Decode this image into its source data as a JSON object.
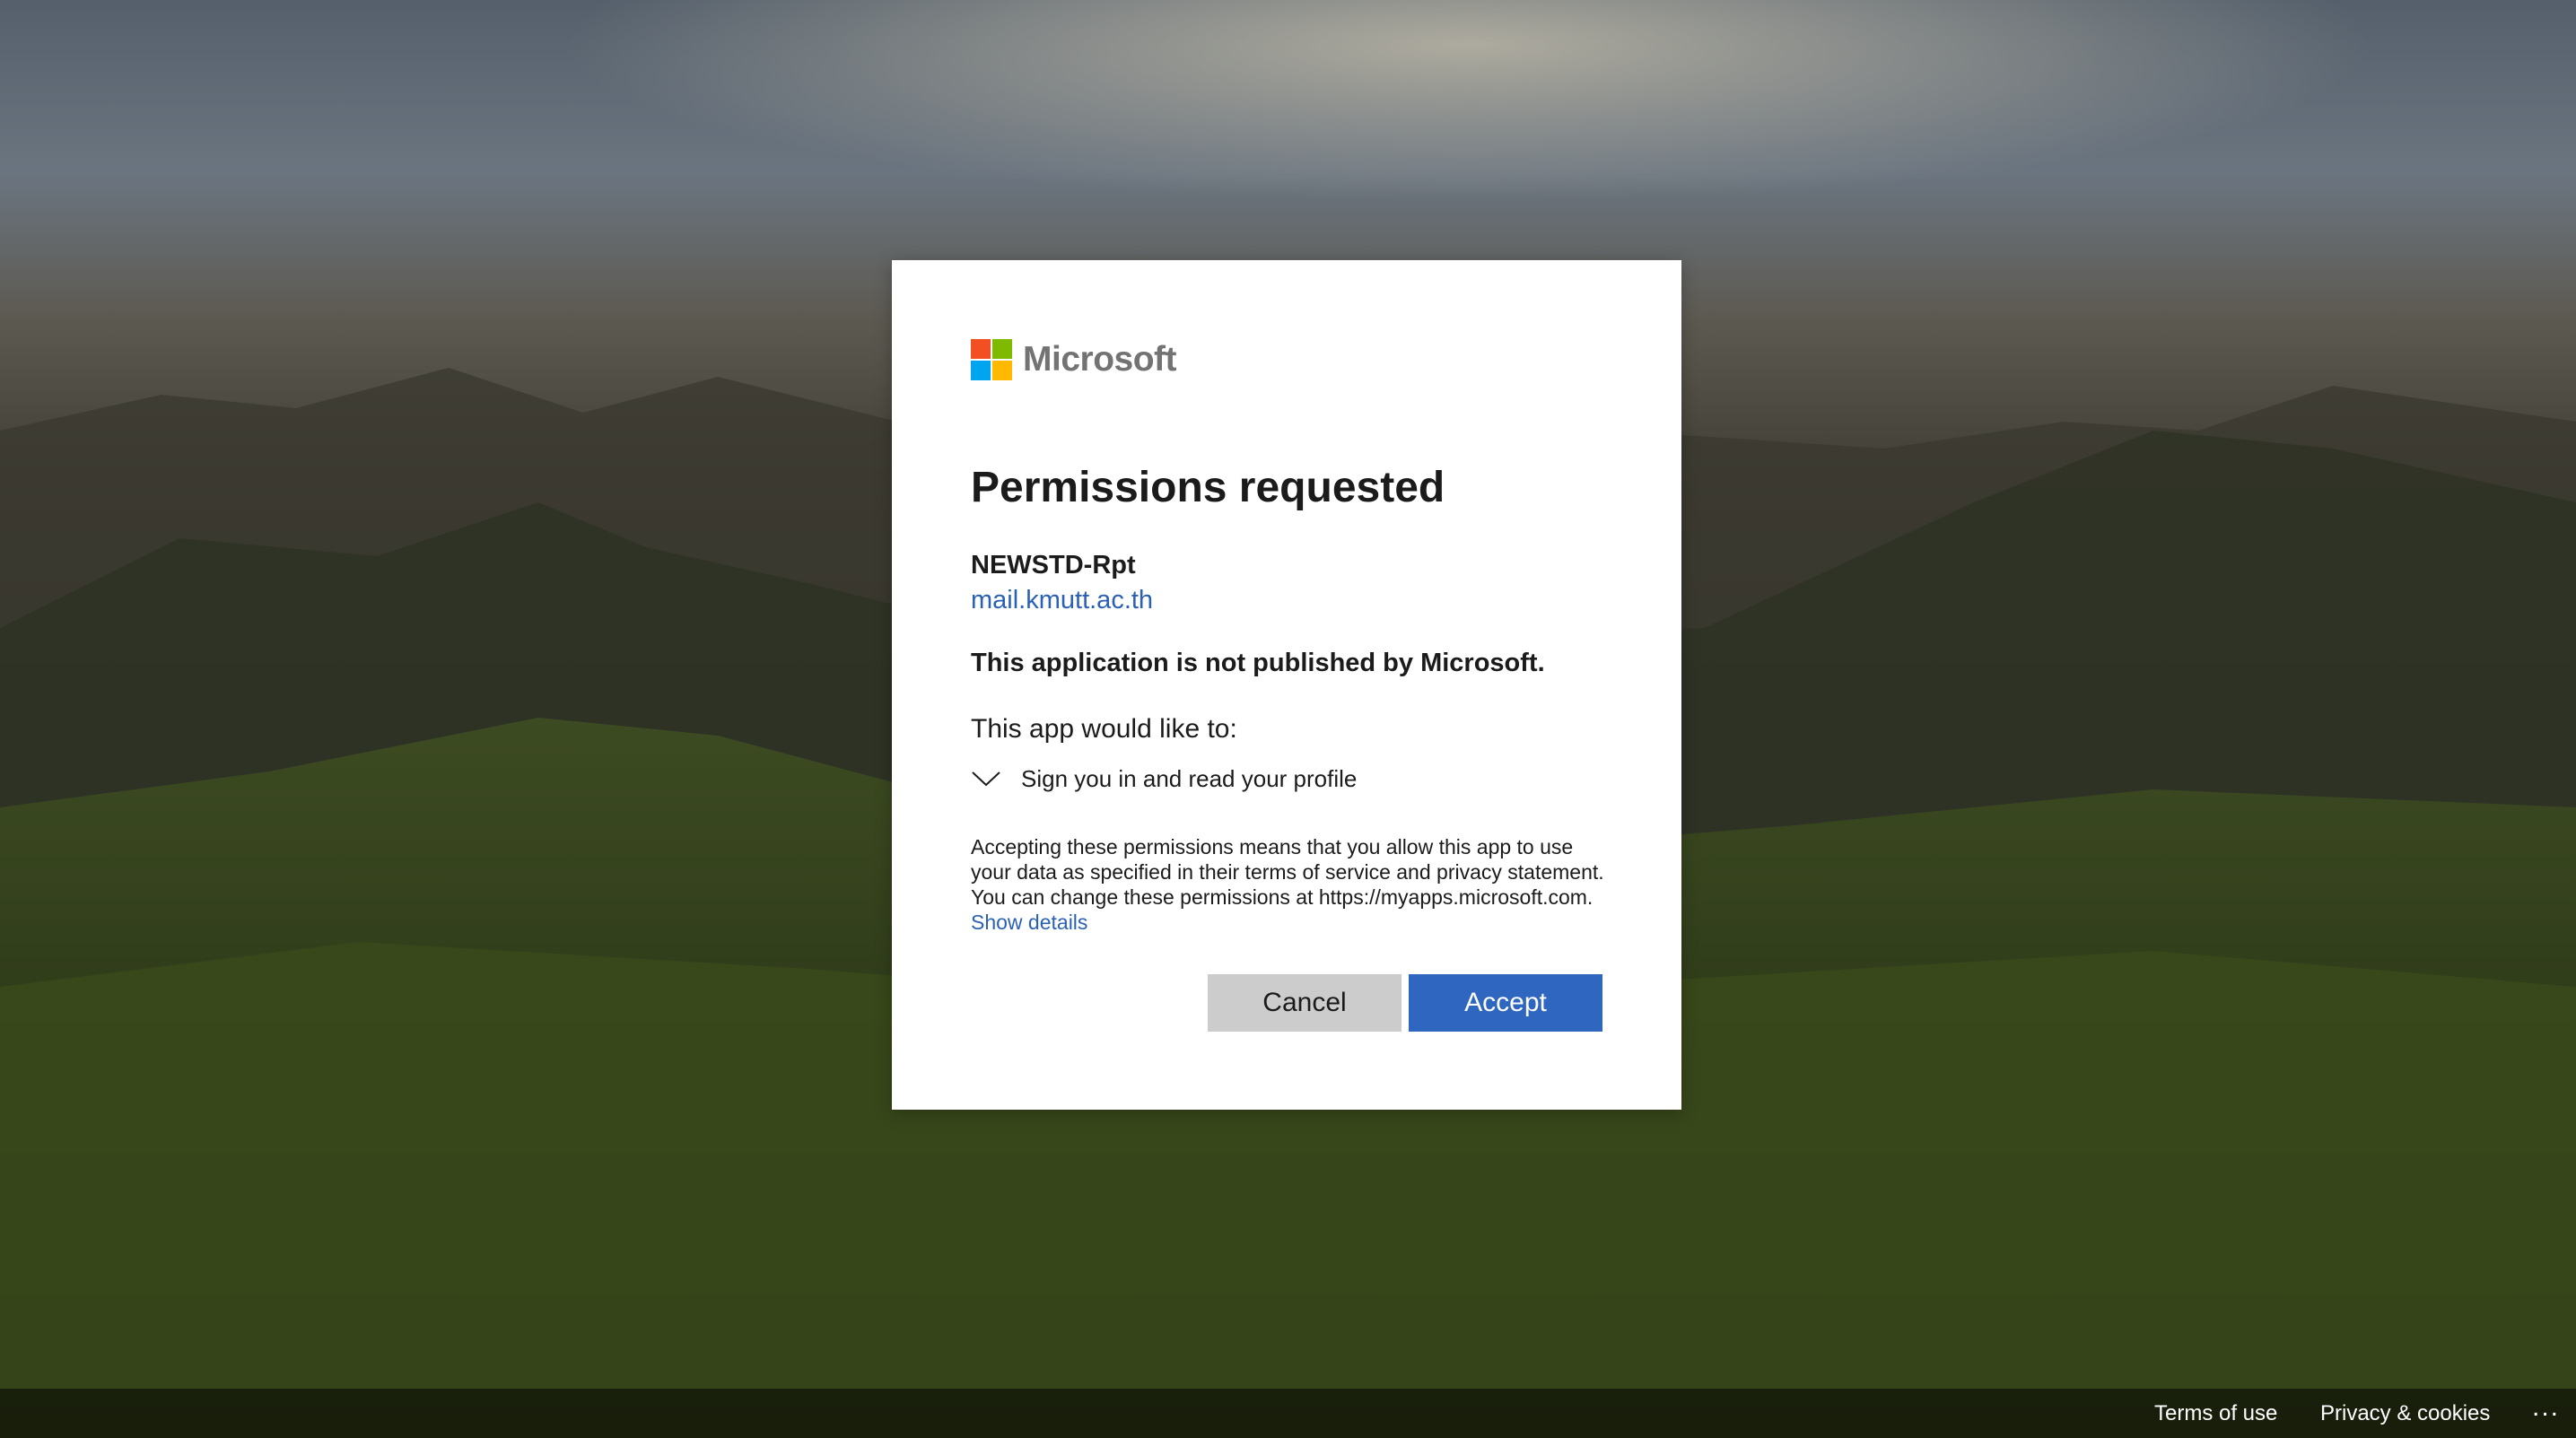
{
  "logo": {
    "brand": "Microsoft",
    "colors": [
      "#f25022",
      "#7fba00",
      "#00a4ef",
      "#ffb900"
    ]
  },
  "dialog": {
    "title": "Permissions requested",
    "app_name": "NEWSTD-Rpt",
    "app_domain": "mail.kmutt.ac.th",
    "warning": "This application is not published by Microsoft.",
    "would_like": "This app would like to:",
    "permissions": [
      {
        "label": "Sign you in and read your profile",
        "icon": "chevron-down-icon"
      }
    ],
    "disclaimer": "Accepting these permissions means that you allow this app to use your data as specified in their terms of service and privacy statement. You can change these permissions at https://myapps.microsoft.com.",
    "show_details": "Show details",
    "cancel_label": "Cancel",
    "accept_label": "Accept"
  },
  "footer": {
    "terms": "Terms of use",
    "privacy": "Privacy & cookies",
    "more": "..."
  },
  "colors": {
    "accent": "#2f66c0",
    "link": "#2b61b5",
    "cancel_bg": "#cccccc"
  }
}
